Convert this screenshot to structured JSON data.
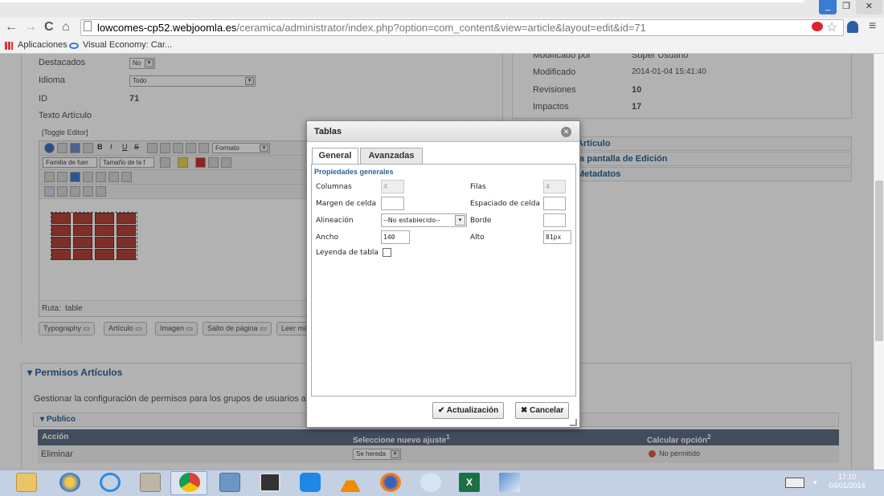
{
  "window": {
    "minimize_glyph": "_",
    "restore_glyph": "❐",
    "close_glyph": "✕"
  },
  "browser": {
    "back_glyph": "←",
    "forward_glyph": "→",
    "reload_glyph": "C",
    "home_glyph": "⌂",
    "url_host": "lowcomes-cp52.webjoomla.es",
    "url_path": "/ceramica/administrator/index.php?option=com_content&view=article&layout=edit&id=71",
    "star_glyph": "☆",
    "menu_glyph": "≡"
  },
  "bookmarks": {
    "apps_label": "Aplicaciones",
    "item1_label": "Visual Economy: Car..."
  },
  "form": {
    "destacados_label": "Destacados",
    "destacados_value": "No",
    "idioma_label": "Idioma",
    "idioma_value": "Todo",
    "id_label": "ID",
    "id_value": "71",
    "texto_label": "Texto Artículo",
    "toggle_editor": "[Toggle Editor]",
    "formato_label": "Formato",
    "font_family_label": "Familia de fuer",
    "font_size_label": "Tamaño de la f",
    "path_label": "Ruta:",
    "path_value": "table",
    "buttons": [
      "Typography",
      "Artículo",
      "Imagen",
      "Salto de página",
      "Leer más"
    ]
  },
  "right_panel": {
    "modificado_por_label": "Modificado por",
    "modificado_por_value": "Super Usuario",
    "modificado_label": "Modificado",
    "modificado_value": "2014-01-04 15:41:40",
    "revisiones_label": "Revisiones",
    "revisiones_value": "10",
    "impactos_label": "Impactos",
    "impactos_value": "17",
    "accordion": [
      "Artículo",
      "la pantalla de Edición",
      "Metadatos"
    ]
  },
  "permissions": {
    "title": "Permisos Artículos",
    "description": "Gestionar la configuración de permisos para los grupos de usuarios a contin",
    "group": "Publico",
    "col_action": "Acción",
    "col_new": "Seleccione nuevo ajuste",
    "col_calc": "Calcular opción",
    "sup1": "1",
    "sup2": "2",
    "row1_action": "Eliminar",
    "row1_setting": "Se hereda",
    "row1_calc": "No permitido"
  },
  "dialog": {
    "title": "Tablas",
    "tab_general": "General",
    "tab_advanced": "Avanzadas",
    "section_title": "Propiedades generales",
    "columnas_label": "Columnas",
    "columnas_value": "4",
    "filas_label": "Filas",
    "filas_value": "4",
    "margen_label": "Margen de celda",
    "margen_value": "",
    "espaciado_label": "Espaciado de celda",
    "espaciado_value": "",
    "alineacion_label": "Alineación",
    "alineacion_value": "--No establecido--",
    "borde_label": "Borde",
    "borde_value": "",
    "ancho_label": "Ancho",
    "ancho_value": "140",
    "alto_label": "Alto",
    "alto_value": "81px",
    "leyenda_label": "Leyenda de tabla",
    "update_label": "Actualización",
    "cancel_label": "Cancelar"
  },
  "taskbar": {
    "time": "17:10",
    "date": "04/01/2014",
    "excel_glyph": "X"
  }
}
